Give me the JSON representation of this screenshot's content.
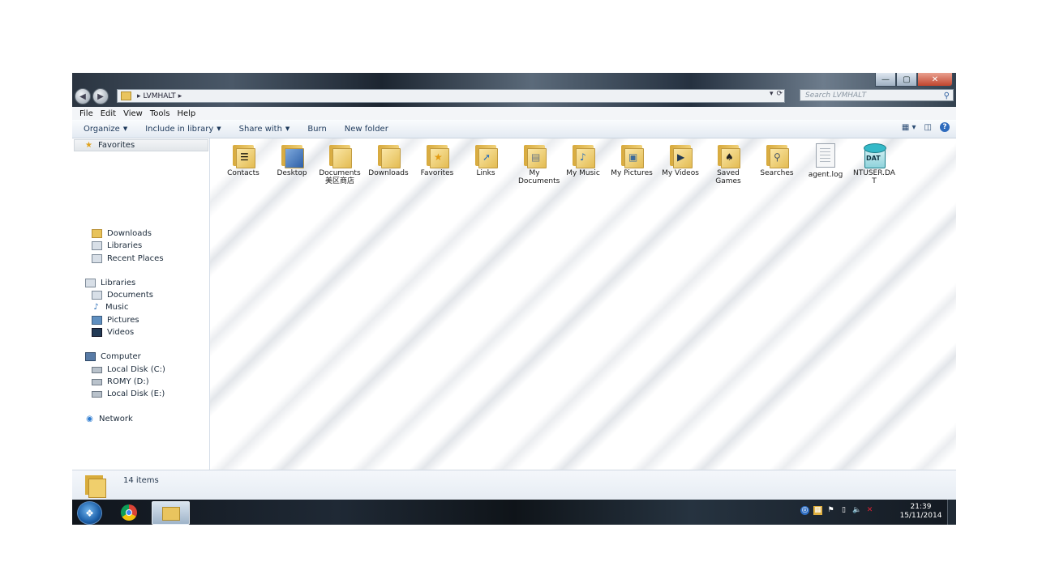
{
  "window": {
    "address_segment": "LVMHALT",
    "search_placeholder": "Search LVMHALT",
    "buttons": {
      "minimize": "—",
      "maximize": "▢",
      "close": "✕"
    }
  },
  "menu": [
    "File",
    "Edit",
    "View",
    "Tools",
    "Help"
  ],
  "commands": {
    "organize": "Organize",
    "include_in_library": "Include in library",
    "share_with": "Share with",
    "burn": "Burn",
    "new_folder": "New folder"
  },
  "nav": {
    "favorites": "Favorites",
    "favorites_items": [
      "Downloads",
      "Libraries",
      "Recent Places"
    ],
    "libraries": "Libraries",
    "libraries_items": [
      "Documents",
      "Music",
      "Pictures",
      "Videos"
    ],
    "computer": "Computer",
    "computer_items": [
      "Local Disk (C:)",
      "ROMY (D:)",
      "Local Disk (E:)"
    ],
    "network": "Network"
  },
  "items": [
    {
      "label": "Contacts",
      "icon": "contacts-folder-icon"
    },
    {
      "label": "Desktop",
      "icon": "desktop-folder-icon"
    },
    {
      "label": "Documents 美区商店",
      "icon": "documents-folder-icon"
    },
    {
      "label": "Downloads",
      "icon": "downloads-folder-icon"
    },
    {
      "label": "Favorites",
      "icon": "favorites-folder-icon"
    },
    {
      "label": "Links",
      "icon": "links-folder-icon"
    },
    {
      "label": "My Documents",
      "icon": "my-documents-folder-icon"
    },
    {
      "label": "My Music",
      "icon": "my-music-folder-icon"
    },
    {
      "label": "My Pictures",
      "icon": "my-pictures-folder-icon"
    },
    {
      "label": "My Videos",
      "icon": "my-videos-folder-icon"
    },
    {
      "label": "Saved Games",
      "icon": "saved-games-folder-icon"
    },
    {
      "label": "Searches",
      "icon": "searches-folder-icon"
    },
    {
      "label": "agent.log",
      "icon": "text-file-icon"
    },
    {
      "label": "NTUSER.DAT",
      "icon": "dat-file-icon"
    }
  ],
  "details": {
    "count": "14 items"
  },
  "taskbar": {
    "time": "21:39",
    "date": "15/11/2014"
  }
}
